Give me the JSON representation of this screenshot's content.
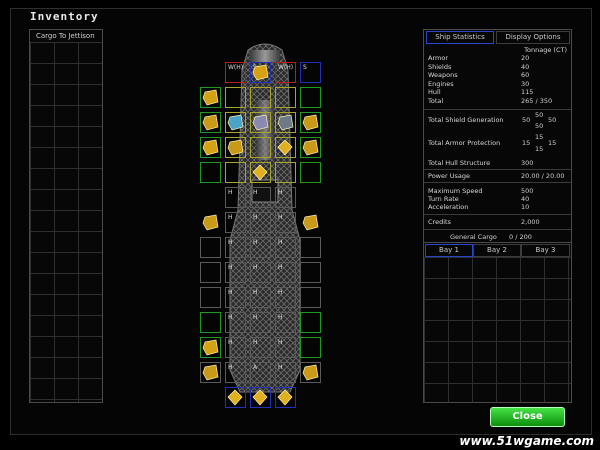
{
  "window": {
    "title": "Inventory"
  },
  "cargo_panel": {
    "title": "Cargo To Jettison"
  },
  "tabs": {
    "ship_statistics": "Ship Statistics",
    "display_options": "Display Options"
  },
  "stats": {
    "tonnage_header": "Tonnage (CT)",
    "rows": [
      {
        "label": "Armor",
        "value": "20"
      },
      {
        "label": "Shields",
        "value": "40"
      },
      {
        "label": "Weapons",
        "value": "60"
      },
      {
        "label": "Engines",
        "value": "30"
      },
      {
        "label": "Hull",
        "value": "115"
      },
      {
        "label": "Total",
        "value": "265 / 350"
      }
    ],
    "shield_generation": {
      "label": "Total Shield Generation",
      "left": "50",
      "top": "50",
      "bottom": "50",
      "right": "50"
    },
    "armor_protection": {
      "label": "Total Armor Protection",
      "left": "15",
      "top": "15",
      "bottom": "15",
      "right": "15"
    },
    "hull_structure": {
      "label": "Total Hull Structure",
      "value": "300"
    },
    "power_usage": {
      "label": "Power Usage",
      "value": "20.00 / 20.00"
    },
    "max_speed": {
      "label": "Maximum Speed",
      "value": "500"
    },
    "turn_rate": {
      "label": "Turn Rate",
      "value": "40"
    },
    "acceleration": {
      "label": "Acceleration",
      "value": "10"
    },
    "credits": {
      "label": "Credits",
      "value": "2,000"
    },
    "general_cargo": {
      "label": "General Cargo",
      "value": "0 / 200"
    }
  },
  "bays": [
    "Bay 1",
    "Bay 2",
    "Bay 3"
  ],
  "ship": {
    "slot_labels": [
      "W(H)",
      "S",
      "W(H)",
      "S",
      "H",
      "H",
      "H",
      "H",
      "H",
      "H",
      "H",
      "H",
      "H",
      "H",
      "H",
      "H",
      "H",
      "H",
      "H",
      "H",
      "H",
      "H",
      "H",
      "H",
      "H",
      "H",
      "A",
      "H",
      "H",
      "H",
      "H",
      "H",
      "H",
      "H",
      "H",
      "H",
      "H",
      "H",
      "H",
      "H",
      "K"
    ],
    "icons": [
      "shield-generator-icon",
      "cannon-icon",
      "engine-icon",
      "armor-plate-icon",
      "crystal-icon",
      "satellite-icon"
    ]
  },
  "buttons": {
    "close": "Close"
  },
  "watermark": "www.51wgame.com"
}
